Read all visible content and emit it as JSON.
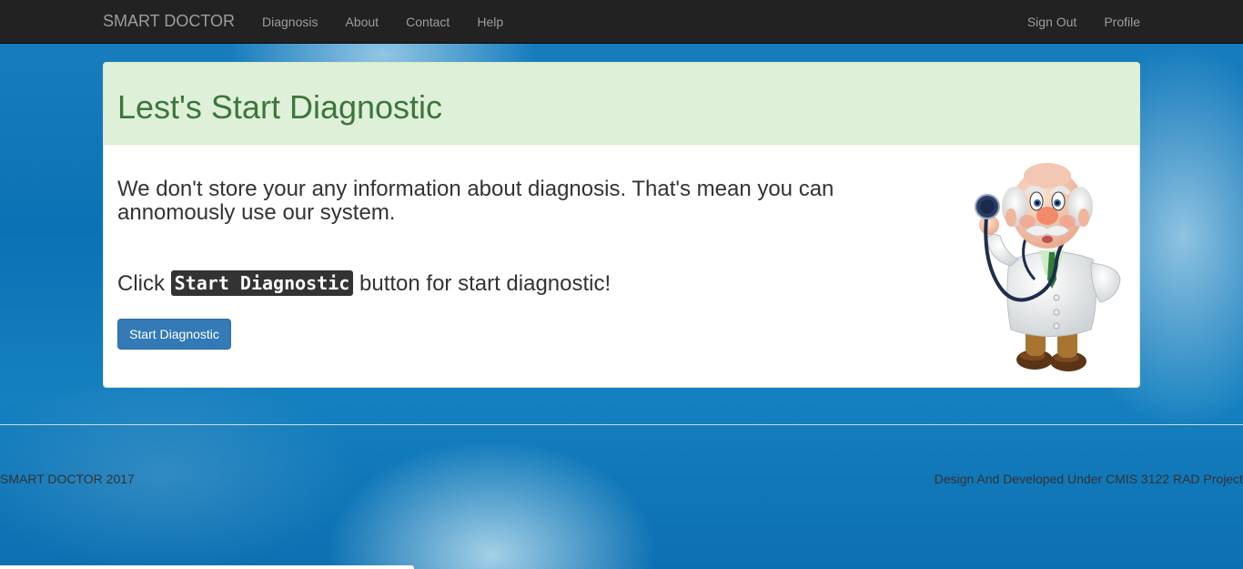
{
  "navbar": {
    "brand": "SMART DOCTOR",
    "left_items": [
      {
        "label": "Diagnosis"
      },
      {
        "label": "About"
      },
      {
        "label": "Contact"
      },
      {
        "label": "Help"
      }
    ],
    "right_items": [
      {
        "label": "Sign Out"
      },
      {
        "label": "Profile"
      }
    ]
  },
  "panel": {
    "title": "Lest's Start Diagnostic",
    "info": "We don't store your any information about diagnosis. That's mean you can annomously use our system.",
    "click_prefix": "Click",
    "click_code": "Start Diagnostic",
    "click_suffix": "button for start diagnostic!",
    "button_label": "Start Diagnostic",
    "illustration_icon": "doctor-cartoon-icon"
  },
  "footer": {
    "left": "SMART DOCTOR 2017",
    "right": "Design And Developed Under CMIS 3122 RAD Project"
  },
  "colors": {
    "navbar_bg": "#222222",
    "nav_text": "#9d9d9d",
    "panel_heading_bg": "#dff0d8",
    "panel_title": "#3c763d",
    "button_primary": "#337ab7",
    "page_bg": "#0b72b5"
  }
}
